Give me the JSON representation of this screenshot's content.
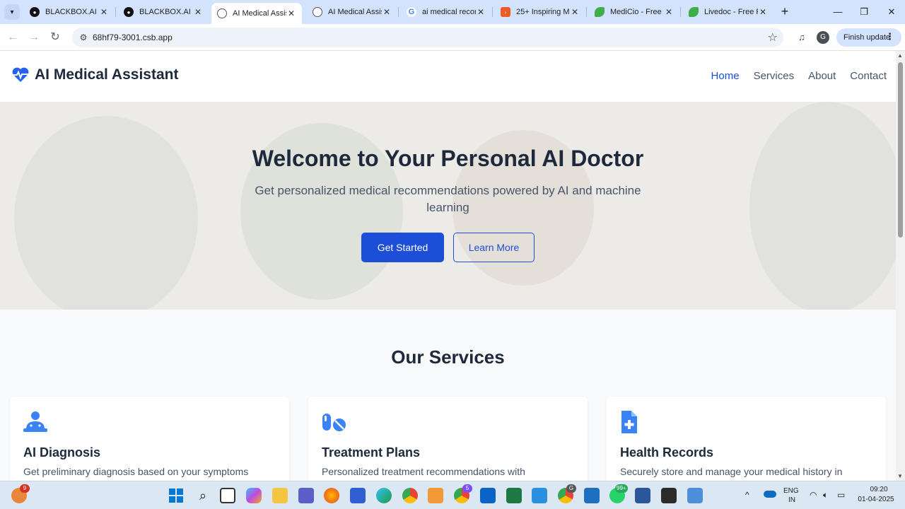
{
  "browser": {
    "tabs": [
      {
        "title": "BLACKBOX.AI",
        "favicon": "blackbox-icon",
        "active": false
      },
      {
        "title": "BLACKBOX.AI",
        "favicon": "blackbox-icon",
        "active": false
      },
      {
        "title": "AI Medical Assist",
        "favicon": "globe-icon",
        "active": true
      },
      {
        "title": "AI Medical Assist",
        "favicon": "globe-icon",
        "active": false
      },
      {
        "title": "ai medical recom",
        "favicon": "google-icon",
        "active": false
      },
      {
        "title": "25+ Inspiring M",
        "favicon": "sitepoint-icon",
        "active": false
      },
      {
        "title": "MediCio - Free R",
        "favicon": "leaf-icon",
        "active": false
      },
      {
        "title": "Livedoc - Free R",
        "favicon": "leaf-icon",
        "active": false
      }
    ],
    "url": "68hf79-3001.csb.app",
    "profile_initial": "G",
    "finish_update_label": "Finish update"
  },
  "site": {
    "brand": "AI Medical Assistant",
    "nav": [
      "Home",
      "Services",
      "About",
      "Contact"
    ],
    "hero": {
      "title": "Welcome to Your Personal AI Doctor",
      "subtitle": "Get personalized medical recommendations powered by AI and machine learning",
      "primary_button": "Get Started",
      "secondary_button": "Learn More"
    },
    "services_title": "Our Services",
    "services": [
      {
        "icon": "doctor-user-icon",
        "title": "AI Diagnosis",
        "description": "Get preliminary diagnosis based on your symptoms"
      },
      {
        "icon": "pills-icon",
        "title": "Treatment Plans",
        "description": "Personalized treatment recommendations with"
      },
      {
        "icon": "medical-file-icon",
        "title": "Health Records",
        "description": "Securely store and manage your medical history in"
      }
    ]
  },
  "colors": {
    "accent": "#1d4ed8",
    "heading": "#1e293b",
    "body_text": "#475569",
    "tab_strip": "#d3e3fd"
  },
  "taskbar": {
    "notification_badge": "9",
    "badge_2": "5",
    "badge_3": "99+",
    "badge_4": "G",
    "language": "ENG",
    "region": "IN",
    "time": "09:20",
    "date": "01-04-2025"
  }
}
